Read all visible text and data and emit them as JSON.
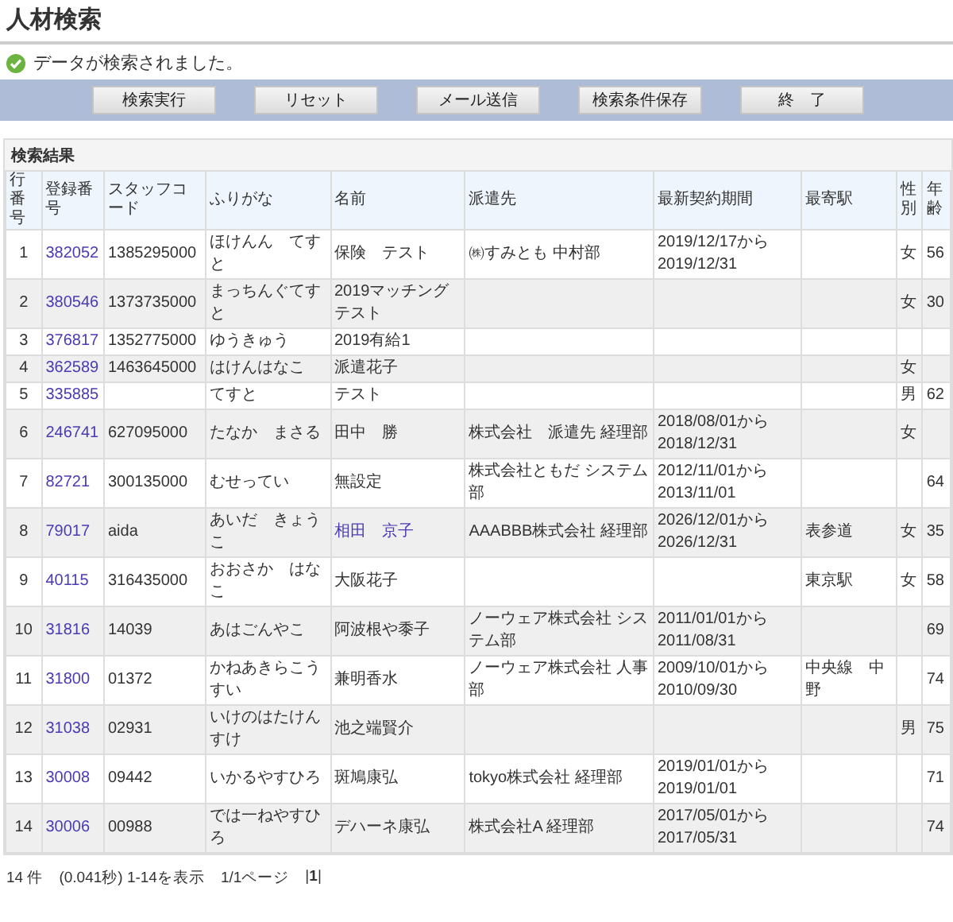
{
  "title": "人材検索",
  "message": {
    "kind": "success",
    "text": "データが検索されました。"
  },
  "buttons": [
    "検索実行",
    "リセット",
    "メール送信",
    "検索条件保存",
    "終　了"
  ],
  "results": {
    "heading": "検索結果",
    "columns": [
      "行番号",
      "登録番号",
      "スタッフコード",
      "ふりがな",
      "名前",
      "派遣先",
      "最新契約期間",
      "最寄駅",
      "性別",
      "年齢"
    ],
    "rows": [
      {
        "no": "1",
        "reg_no": "382052",
        "staff_code": "1385295000",
        "furigana": "ほけんん　てすと",
        "name": "保険　テスト",
        "name_link": false,
        "dispatch": "㈱すみとも 中村部",
        "period": "2019/12/17から\n2019/12/31",
        "sex": "女",
        "age": "56"
      },
      {
        "no": "2",
        "reg_no": "380546",
        "staff_code": "1373735000",
        "furigana": "まっちんぐてすと",
        "name": "2019マッチングテスト",
        "name_link": false,
        "sex": "女",
        "age": "30"
      },
      {
        "no": "3",
        "reg_no": "376817",
        "staff_code": "1352775000",
        "furigana": "ゆうきゅう",
        "name": "2019有給1",
        "name_link": false
      },
      {
        "no": "4",
        "reg_no": "362589",
        "staff_code": "1463645000",
        "furigana": "はけんはなこ",
        "name": "派遣花子",
        "name_link": false,
        "sex": "女"
      },
      {
        "no": "5",
        "reg_no": "335885",
        "furigana": "てすと",
        "name": "テスト",
        "name_link": false,
        "sex": "男",
        "age": "62"
      },
      {
        "no": "6",
        "reg_no": "246741",
        "staff_code": "627095000",
        "furigana": "たなか　まさる",
        "name": "田中　勝",
        "name_link": false,
        "dispatch": "株式会社　派遣先 経理部",
        "period": "2018/08/01から\n2018/12/31",
        "sex": "女"
      },
      {
        "no": "7",
        "reg_no": "82721",
        "staff_code": "300135000",
        "furigana": "むせってい",
        "name": "無設定",
        "name_link": false,
        "dispatch": "株式会社ともだ システム部",
        "period": "2012/11/01から\n2013/11/01",
        "age": "64"
      },
      {
        "no": "8",
        "reg_no": "79017",
        "staff_code": "aida",
        "furigana": "あいだ　きょうこ",
        "name": "相田　京子",
        "name_link": true,
        "dispatch": "AAABBB株式会社 経理部",
        "period": "2026/12/01から\n2026/12/31",
        "station": "表参道",
        "sex": "女",
        "age": "35"
      },
      {
        "no": "9",
        "reg_no": "40115",
        "staff_code": "316435000",
        "furigana": "おおさか　はなこ",
        "name": "大阪花子",
        "name_link": false,
        "station": "東京駅",
        "sex": "女",
        "age": "58"
      },
      {
        "no": "10",
        "reg_no": "31816",
        "staff_code": "14039",
        "furigana": "あはごんやこ",
        "name": "阿波根や黍子",
        "name_link": false,
        "dispatch": "ノーウェア株式会社 システム部",
        "period": "2011/01/01から\n2011/08/31",
        "age": "69"
      },
      {
        "no": "11",
        "reg_no": "31800",
        "staff_code": "01372",
        "furigana": "かねあきらこうすい",
        "name": "兼明香水",
        "name_link": false,
        "dispatch": "ノーウェア株式会社 人事部",
        "period": "2009/10/01から\n2010/09/30",
        "station": "中央線　中野",
        "age": "74"
      },
      {
        "no": "12",
        "reg_no": "31038",
        "staff_code": "02931",
        "furigana": "いけのはたけんすけ",
        "name": "池之端賢介",
        "name_link": false,
        "sex": "男",
        "age": "75"
      },
      {
        "no": "13",
        "reg_no": "30008",
        "staff_code": "09442",
        "furigana": "いかるやすひろ",
        "name": "斑鳩康弘",
        "name_link": false,
        "dispatch": "tokyo株式会社 経理部",
        "period": "2019/01/01から\n2019/01/01",
        "age": "71"
      },
      {
        "no": "14",
        "reg_no": "30006",
        "staff_code": "00988",
        "furigana": "では一ねやすひろ",
        "name": "デハーネ康弘",
        "name_link": false,
        "dispatch": "株式会社A 経理部",
        "period": "2017/05/01から\n2017/05/31",
        "age": "74"
      }
    ]
  },
  "footer": {
    "summary": "14 件　(0.041秒) 1-14を表示　1/1ページ",
    "pager": "|**1**|"
  }
}
